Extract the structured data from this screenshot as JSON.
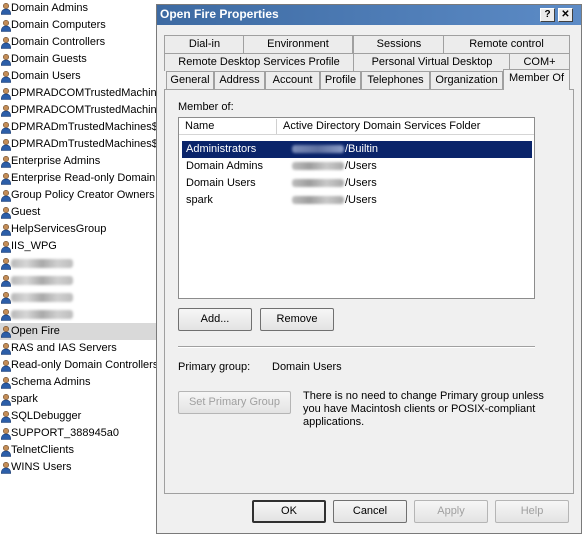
{
  "ad_list": {
    "items": [
      {
        "label": "Domain Admins",
        "blurred": false
      },
      {
        "label": "Domain Computers",
        "blurred": false
      },
      {
        "label": "Domain Controllers",
        "blurred": false
      },
      {
        "label": "Domain Guests",
        "blurred": false
      },
      {
        "label": "Domain Users",
        "blurred": false
      },
      {
        "label": "DPMRADCOMTrustedMachines",
        "blurred": false
      },
      {
        "label": "DPMRADCOMTrustedMachines",
        "blurred": false
      },
      {
        "label": "DPMRADmTrustedMachines$C",
        "blurred": false
      },
      {
        "label": "DPMRADmTrustedMachines$C",
        "blurred": false
      },
      {
        "label": "Enterprise Admins",
        "blurred": false
      },
      {
        "label": "Enterprise Read-only Domain C",
        "blurred": false
      },
      {
        "label": "Group Policy Creator Owners",
        "blurred": false
      },
      {
        "label": "Guest",
        "blurred": false
      },
      {
        "label": "HelpServicesGroup",
        "blurred": false
      },
      {
        "label": "IIS_WPG",
        "blurred": false
      },
      {
        "label": "",
        "blurred": true
      },
      {
        "label": "",
        "blurred": true
      },
      {
        "label": "",
        "blurred": true
      },
      {
        "label": "",
        "blurred": true
      },
      {
        "label": "Open Fire",
        "blurred": false,
        "selected": true
      },
      {
        "label": "RAS and IAS Servers",
        "blurred": false
      },
      {
        "label": "Read-only Domain Controllers",
        "blurred": false
      },
      {
        "label": "Schema Admins",
        "blurred": false
      },
      {
        "label": "spark",
        "blurred": false
      },
      {
        "label": "SQLDebugger",
        "blurred": false
      },
      {
        "label": "SUPPORT_388945a0",
        "blurred": false
      },
      {
        "label": "TelnetClients",
        "blurred": false
      },
      {
        "label": "WINS Users",
        "blurred": false
      }
    ]
  },
  "dialog": {
    "title": "Open Fire Properties",
    "help_glyph": "?",
    "close_glyph": "✕",
    "tabs_row1": [
      "Dial-in",
      "Environment",
      "Sessions",
      "Remote control"
    ],
    "tabs_row2": [
      "Remote Desktop Services Profile",
      "Personal Virtual Desktop",
      "COM+"
    ],
    "tabs_row3": [
      "General",
      "Address",
      "Account",
      "Profile",
      "Telephones",
      "Organization",
      "Member Of"
    ],
    "member_of_label": "Member of:",
    "columns": [
      "Name",
      "Active Directory Domain Services Folder"
    ],
    "members": [
      {
        "name": "Administrators",
        "folder": "/Builtin",
        "selected": true
      },
      {
        "name": "Domain Admins",
        "folder": "/Users",
        "selected": false
      },
      {
        "name": "Domain Users",
        "folder": "/Users",
        "selected": false
      },
      {
        "name": "spark",
        "folder": "/Users",
        "selected": false
      }
    ],
    "add_label": "Add...",
    "remove_label": "Remove",
    "primary_group_label": "Primary group:",
    "primary_group_value": "Domain Users",
    "set_primary_label": "Set Primary Group",
    "primary_note": [
      "There is no need to change Primary group unless",
      "you have Macintosh clients or POSIX-compliant",
      "applications."
    ],
    "ok_label": "OK",
    "cancel_label": "Cancel",
    "apply_label": "Apply",
    "help_label": "Help"
  }
}
